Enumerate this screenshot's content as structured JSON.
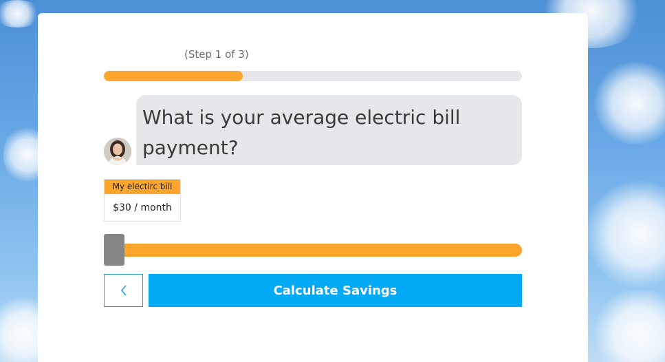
{
  "progress": {
    "step_text": "(Step 1 of 3)",
    "fraction": 0.333
  },
  "question": {
    "line1": "What is your average electric bill",
    "line2": "payment?"
  },
  "bill": {
    "header": "My electirc bill",
    "value": "$30 / month"
  },
  "slider": {
    "level": 0
  },
  "buttons": {
    "back_icon": "chevron-left-icon",
    "calculate_label": "Calculate Savings"
  },
  "colors": {
    "accent_orange": "#fba52c",
    "primary_blue": "#03a9f4",
    "bubble_gray": "#e6e7ea",
    "handle_gray": "#858585"
  }
}
